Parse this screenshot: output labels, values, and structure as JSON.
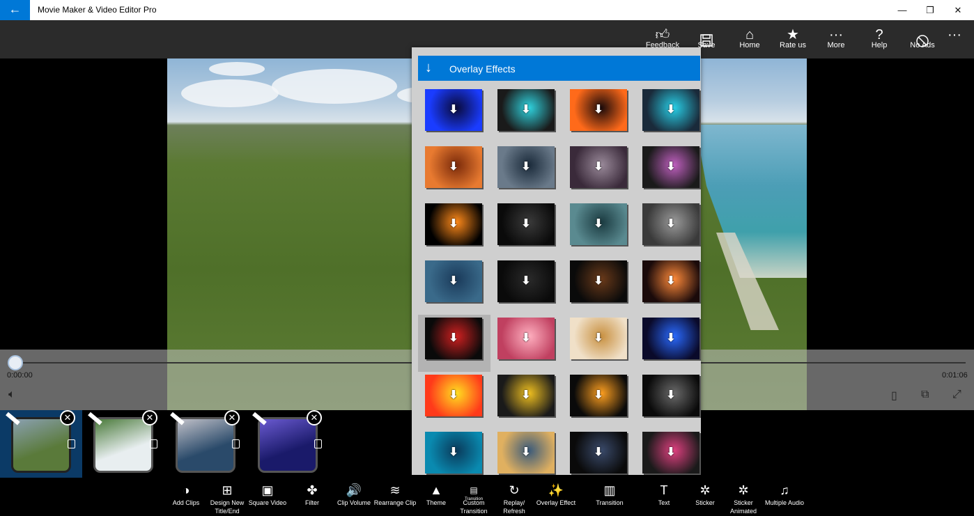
{
  "window": {
    "title": "Movie Maker & Video Editor Pro",
    "back_glyph": "←",
    "minimize_glyph": "—",
    "restore_glyph": "❐",
    "close_glyph": "✕"
  },
  "command_bar": {
    "items": [
      {
        "label": "Feedback",
        "icon": "thumbs-up-icon"
      },
      {
        "label": "Save",
        "icon": "save-icon"
      },
      {
        "label": "Home",
        "icon": "home-icon"
      },
      {
        "label": "Rate us",
        "icon": "star-icon"
      },
      {
        "label": "More",
        "icon": "more-dots-icon"
      },
      {
        "label": "Help",
        "icon": "question-icon"
      },
      {
        "label": "No Ads",
        "icon": "no-ads-icon"
      }
    ],
    "overflow_glyph": "···"
  },
  "player": {
    "current_time": "0:00:00",
    "total_time": "0:01:06",
    "progress": 0
  },
  "overlay_panel": {
    "title": "Overlay Effects",
    "download_glyph": "⬇",
    "tiles": [
      {
        "c1": "#1a3cff",
        "c2": "#0a0a3a"
      },
      {
        "c1": "#1a1a1a",
        "c2": "#2fd4e0"
      },
      {
        "c1": "#ff6a1a",
        "c2": "#1a0a0a"
      },
      {
        "c1": "#1a2a3a",
        "c2": "#28d0e8"
      },
      {
        "c1": "#e87a30",
        "c2": "#7a2a0a"
      },
      {
        "c1": "#6a7a8a",
        "c2": "#1a2a3a"
      },
      {
        "c1": "#3a2a3a",
        "c2": "#9a8a9a"
      },
      {
        "c1": "#1a1a1a",
        "c2": "#c060c0"
      },
      {
        "c1": "#000000",
        "c2": "#ff8a1a"
      },
      {
        "c1": "#0a0a0a",
        "c2": "#3a3a3a"
      },
      {
        "c1": "#5a8a90",
        "c2": "#1a3a40"
      },
      {
        "c1": "#3a3a3a",
        "c2": "#9a9a9a"
      },
      {
        "c1": "#3a6a8a",
        "c2": "#1a3a5a"
      },
      {
        "c1": "#0a0a0a",
        "c2": "#2a2a2a"
      },
      {
        "c1": "#0a0a0a",
        "c2": "#6a3a1a"
      },
      {
        "c1": "#1a0a0a",
        "c2": "#ff8a3a"
      },
      {
        "c1": "#0a0a0a",
        "c2": "#d02020"
      },
      {
        "c1": "#c04060",
        "c2": "#ffb0c0"
      },
      {
        "c1": "#f0e0c8",
        "c2": "#c89040"
      },
      {
        "c1": "#0a0a2a",
        "c2": "#2a6aff"
      },
      {
        "c1": "#ff3a1a",
        "c2": "#ffe020"
      },
      {
        "c1": "#1a1a1a",
        "c2": "#f0c020"
      },
      {
        "c1": "#0a0a0a",
        "c2": "#ffa020"
      },
      {
        "c1": "#0a0a0a",
        "c2": "#6a6a6a"
      },
      {
        "c1": "#0a8ab0",
        "c2": "#0a3a5a"
      },
      {
        "c1": "#e0b060",
        "c2": "#3a5a7a"
      },
      {
        "c1": "#0a0a0a",
        "c2": "#3a4a6a"
      },
      {
        "c1": "#1a1a1a",
        "c2": "#e04080"
      }
    ],
    "highlighted_index": 16
  },
  "timeline": {
    "clips": [
      {
        "c1": "#5a7a3a",
        "c2": "#8aa0b0",
        "selected": true
      },
      {
        "c1": "#e8eef0",
        "c2": "#4a7a3a",
        "selected": false
      },
      {
        "c1": "#2a4a6a",
        "c2": "#c0c0c8",
        "selected": false
      },
      {
        "c1": "#1a1a6a",
        "c2": "#6a5ad0",
        "selected": false
      }
    ],
    "close_glyph": "✕"
  },
  "toolbar": {
    "items": [
      {
        "label": "Add Clips",
        "icon": "add-clips-icon",
        "glyph": "◑"
      },
      {
        "label": "Design New Title/End",
        "icon": "design-title-icon",
        "glyph": "⊞"
      },
      {
        "label": "Square Video",
        "icon": "square-video-icon",
        "glyph": "▣"
      },
      {
        "label": "Filter",
        "icon": "filter-icon",
        "glyph": "✤"
      },
      {
        "label": "Clip Volume",
        "icon": "clip-volume-icon",
        "glyph": "🔊"
      },
      {
        "label": "Rearrange Clip",
        "icon": "rearrange-icon",
        "glyph": "≋"
      },
      {
        "label": "Theme",
        "icon": "theme-icon",
        "glyph": "▲"
      },
      {
        "label": "Custom Transition",
        "icon": "custom-transition-icon",
        "glyph": "▤"
      },
      {
        "label": "Replay/ Refresh",
        "icon": "replay-icon",
        "glyph": "↻"
      },
      {
        "label": "Overlay Effect",
        "icon": "overlay-effect-icon",
        "glyph": "✨"
      },
      {
        "label": "Transition",
        "icon": "transition-icon",
        "glyph": "▥"
      },
      {
        "label": "Text",
        "icon": "text-icon",
        "glyph": "T"
      },
      {
        "label": "Sticker",
        "icon": "sticker-icon",
        "glyph": "✲"
      },
      {
        "label": "Sticker Animated",
        "icon": "sticker-animated-icon",
        "glyph": "✲"
      },
      {
        "label": "Multiple Audio",
        "icon": "multiple-audio-icon",
        "glyph": "♫"
      }
    ],
    "custom_transition_sub": "Transition"
  }
}
